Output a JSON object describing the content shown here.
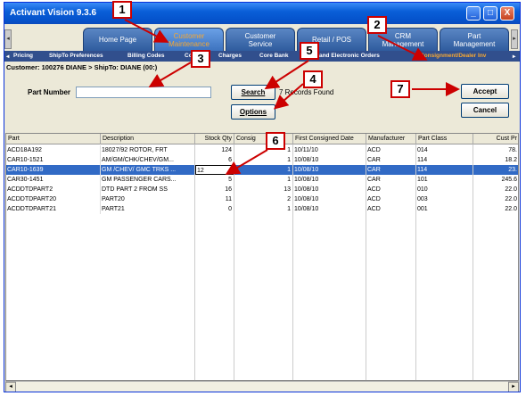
{
  "window": {
    "title": "Activant Vision 9.3.6",
    "min": "_",
    "max": "□",
    "close": "X"
  },
  "tabs": [
    {
      "label1": "Home Page",
      "label2": ""
    },
    {
      "label1": "Customer",
      "label2": "Maintenance"
    },
    {
      "label1": "Customer",
      "label2": "Service"
    },
    {
      "label1": "Retail / POS",
      "label2": ""
    },
    {
      "label1": "CRM",
      "label2": "Management"
    },
    {
      "label1": "Part",
      "label2": "Management"
    }
  ],
  "subtabs": [
    "Pricing",
    "ShipTo Preferences",
    "Billing Codes",
    "Co",
    "Charges",
    "Core Bank",
    "icing and Electronic Orders",
    "Consignment/Dealer Inv"
  ],
  "customer_bar": "Customer: 100276 DIANE > ShipTo: DIANE (00:)",
  "search": {
    "part_label": "Part Number",
    "part_value": "",
    "search_btn": "Search",
    "options_btn": "Options",
    "records": "7 Records Found",
    "accept_btn": "Accept",
    "cancel_btn": "Cancel"
  },
  "table": {
    "headers": [
      "Part",
      "Description",
      "Stock Qty",
      "Consig",
      "First Consigned Date",
      "Manufacturer",
      "Part Class",
      "Cust Pr"
    ],
    "rows": [
      [
        "ACD18A192",
        "18027/92 ROTOR, FRT",
        "124",
        "1",
        "10/11/10",
        "ACD",
        "014",
        "78."
      ],
      [
        "CAR10-1521",
        "AM/GM/CHK/CHEV/GM...",
        "6",
        "1",
        "10/08/10",
        "CAR",
        "114",
        "18.2"
      ],
      [
        "CAR10-1639",
        "GM /CHEV/ GMC TRKS ...",
        "12",
        "1",
        "10/08/10",
        "CAR",
        "114",
        "23."
      ],
      [
        "CAR30-1451",
        "GM PASSENGER CARS...",
        "5",
        "1",
        "10/08/10",
        "CAR",
        "101",
        "245.6"
      ],
      [
        "ACDDTDPART2",
        "DTD PART 2 FROM SS",
        "16",
        "13",
        "10/08/10",
        "ACD",
        "010",
        "22.0"
      ],
      [
        "ACDDTDPART20",
        "PART20",
        "11",
        "2",
        "10/08/10",
        "ACD",
        "003",
        "22.0"
      ],
      [
        "ACDDTDPART21",
        "PART21",
        "0",
        "1",
        "10/08/10",
        "ACD",
        "001",
        "22.0"
      ]
    ]
  },
  "callouts": [
    "1",
    "2",
    "3",
    "4",
    "5",
    "6",
    "7"
  ],
  "colors": {
    "accent": "#316ac5",
    "callout_red": "#cc0000",
    "subtab_bg": "#314f8d"
  }
}
